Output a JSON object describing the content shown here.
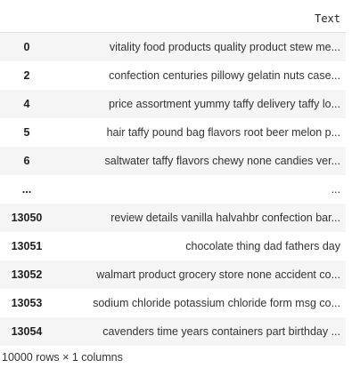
{
  "table": {
    "columns": [
      "",
      "Text"
    ],
    "rows": [
      {
        "index": "0",
        "text": "vitality food products quality product stew me..."
      },
      {
        "index": "2",
        "text": "confection centuries pillowy gelatin nuts case..."
      },
      {
        "index": "4",
        "text": "price assortment yummy taffy delivery taffy lo..."
      },
      {
        "index": "5",
        "text": "hair taffy pound bag flavors root beer melon p..."
      },
      {
        "index": "6",
        "text": "saltwater taffy flavors chewy none candies ver..."
      },
      {
        "index": "...",
        "text": "..."
      },
      {
        "index": "13050",
        "text": "review details vanilla halvahbr confection bar..."
      },
      {
        "index": "13051",
        "text": "chocolate thing dad fathers day"
      },
      {
        "index": "13052",
        "text": "walmart product grocery store none accident co..."
      },
      {
        "index": "13053",
        "text": "sodium chloride potassium chloride form msg co..."
      },
      {
        "index": "13054",
        "text": "cavenders time years containers part birthday ..."
      }
    ]
  },
  "footer": "10000 rows × 1 columns"
}
